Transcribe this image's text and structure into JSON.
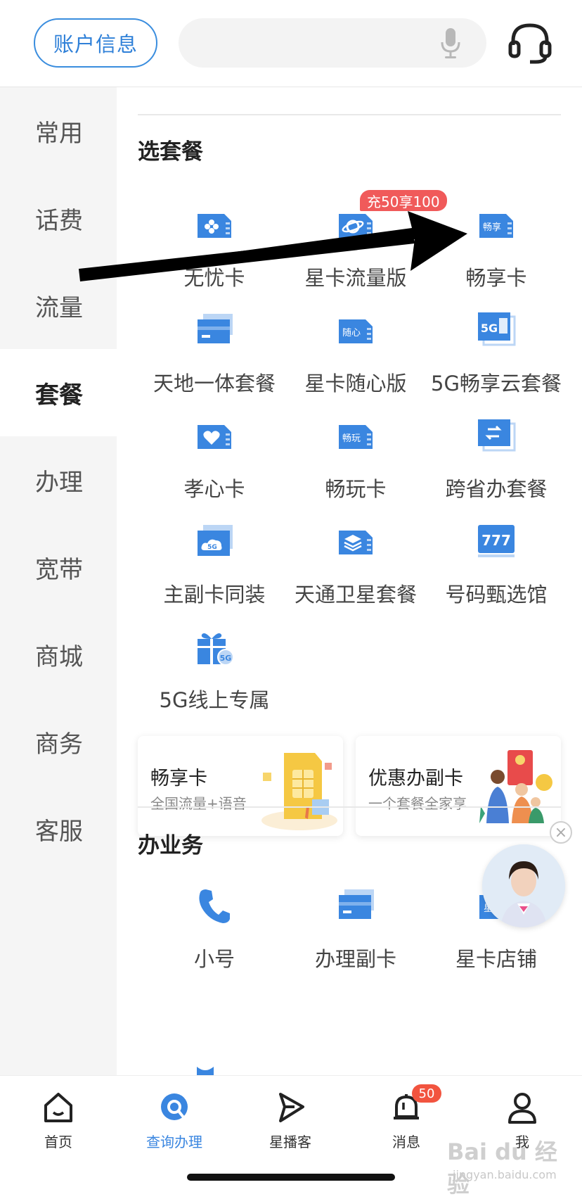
{
  "header": {
    "account_label": "账户信息",
    "search_placeholder": ""
  },
  "sidebar": {
    "items": [
      {
        "label": "常用"
      },
      {
        "label": "话费"
      },
      {
        "label": "流量"
      },
      {
        "label": "套餐"
      },
      {
        "label": "办理"
      },
      {
        "label": "宽带"
      },
      {
        "label": "商城"
      },
      {
        "label": "商务"
      },
      {
        "label": "客服"
      }
    ],
    "active_index": 3
  },
  "plans": {
    "title": "选套餐",
    "promo_badge": "充50享100",
    "items": [
      {
        "label": "无忧卡",
        "icon": "gamepad-card-icon"
      },
      {
        "label": "星卡流量版",
        "icon": "planet-card-icon"
      },
      {
        "label": "畅享卡",
        "icon": "changxiang-card-icon",
        "icon_text": "畅享"
      },
      {
        "label": "天地一体套餐",
        "icon": "stacked-cards-icon"
      },
      {
        "label": "星卡随心版",
        "icon": "suixin-card-icon",
        "icon_text": "随心"
      },
      {
        "label": "5G畅享云套餐",
        "icon": "5g-cloud-icon",
        "icon_text": "5G"
      },
      {
        "label": "孝心卡",
        "icon": "heart-card-icon"
      },
      {
        "label": "畅玩卡",
        "icon": "changwan-card-icon",
        "icon_text": "畅玩"
      },
      {
        "label": "跨省办套餐",
        "icon": "transfer-card-icon"
      },
      {
        "label": "主副卡同装",
        "icon": "5g-cloud-card-icon"
      },
      {
        "label": "天通卫星套餐",
        "icon": "layers-card-icon"
      },
      {
        "label": "号码甄选馆",
        "icon": "number-777-icon",
        "icon_text": "777"
      },
      {
        "label": "5G线上专属",
        "icon": "gift-5g-icon"
      }
    ]
  },
  "promos": [
    {
      "title": "畅享卡",
      "subtitle": "全国流量+语音"
    },
    {
      "title": "优惠办副卡",
      "subtitle": "一个套餐全家享"
    }
  ],
  "business": {
    "title": "办业务",
    "items": [
      {
        "label": "小号",
        "icon": "phone-icon"
      },
      {
        "label": "办理副卡",
        "icon": "cards-icon"
      },
      {
        "label": "星卡店铺",
        "icon": "star-card-shop-icon",
        "icon_text": "星卡"
      }
    ]
  },
  "tabbar": {
    "items": [
      {
        "label": "首页",
        "icon": "home-icon"
      },
      {
        "label": "查询办理",
        "icon": "search-icon"
      },
      {
        "label": "星播客",
        "icon": "play-icon"
      },
      {
        "label": "消息",
        "icon": "bell-icon"
      },
      {
        "label": "我",
        "icon": "user-icon"
      }
    ],
    "active_index": 1,
    "message_badge": "50"
  },
  "watermark": {
    "line1": "Bai du 经验",
    "line2": "jingyan.baidu.com"
  },
  "colors": {
    "accent": "#3a86e0",
    "badge": "#f05a5a",
    "sidebar_bg": "#f5f5f5"
  }
}
